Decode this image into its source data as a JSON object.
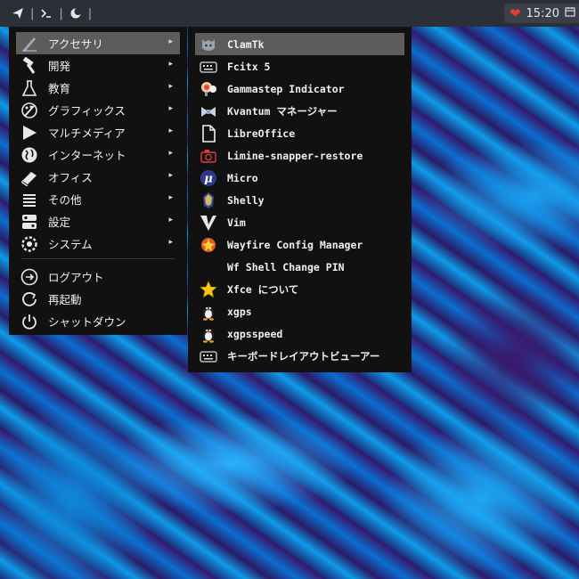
{
  "topbar": {
    "launchers": [
      {
        "icon": "paper-plane-icon"
      },
      {
        "icon": "terminal-icon"
      },
      {
        "icon": "night-mode-icon"
      }
    ],
    "separator": "|",
    "tray": {
      "heart_icon": "heart-icon",
      "time": "15:20",
      "calendar_icon": "calendar-icon"
    }
  },
  "menu": {
    "categories": [
      {
        "label": "アクセサリ",
        "icon": "accessories-icon",
        "arrow": "▸"
      },
      {
        "label": "開発",
        "icon": "hammer-icon",
        "arrow": "▸"
      },
      {
        "label": "教育",
        "icon": "flask-icon",
        "arrow": "▸"
      },
      {
        "label": "グラフィックス",
        "icon": "palette-icon",
        "arrow": "▸"
      },
      {
        "label": "マルチメディア",
        "icon": "play-icon",
        "arrow": "▸"
      },
      {
        "label": "インターネット",
        "icon": "globe-icon",
        "arrow": "▸"
      },
      {
        "label": "オフィス",
        "icon": "book-icon",
        "arrow": "▸"
      },
      {
        "label": "その他",
        "icon": "list-icon",
        "arrow": "▸"
      },
      {
        "label": "設定",
        "icon": "settings-toggle-icon",
        "arrow": "▸"
      },
      {
        "label": "システム",
        "icon": "gear-icon",
        "arrow": "▸"
      }
    ],
    "actions": [
      {
        "label": "ログアウト",
        "icon": "logout-icon"
      },
      {
        "label": "再起動",
        "icon": "restart-icon"
      },
      {
        "label": "シャットダウン",
        "icon": "power-icon"
      }
    ]
  },
  "submenu": {
    "items": [
      {
        "label": "ClamTk",
        "icon": "clamtk-icon"
      },
      {
        "label": "Fcitx 5",
        "icon": "keyboard-icon"
      },
      {
        "label": "Gammastep Indicator",
        "icon": "gammastep-icon"
      },
      {
        "label": "Kvantum マネージャー",
        "icon": "kvantum-icon"
      },
      {
        "label": "LibreOffice",
        "icon": "document-icon"
      },
      {
        "label": "Limine-snapper-restore",
        "icon": "camera-icon"
      },
      {
        "label": "Micro",
        "icon": "micro-icon"
      },
      {
        "label": "Shelly",
        "icon": "shelly-icon"
      },
      {
        "label": "Vim",
        "icon": "vim-icon"
      },
      {
        "label": "Wayfire Config Manager",
        "icon": "wayfire-icon"
      },
      {
        "label": "Wf Shell Change PIN",
        "icon": "none"
      },
      {
        "label": "Xfce について",
        "icon": "star-icon"
      },
      {
        "label": "xgps",
        "icon": "penguin-icon"
      },
      {
        "label": "xgpsspeed",
        "icon": "penguin-icon"
      },
      {
        "label": "キーボードレイアウトビューアー",
        "icon": "keyboard-icon"
      }
    ]
  }
}
